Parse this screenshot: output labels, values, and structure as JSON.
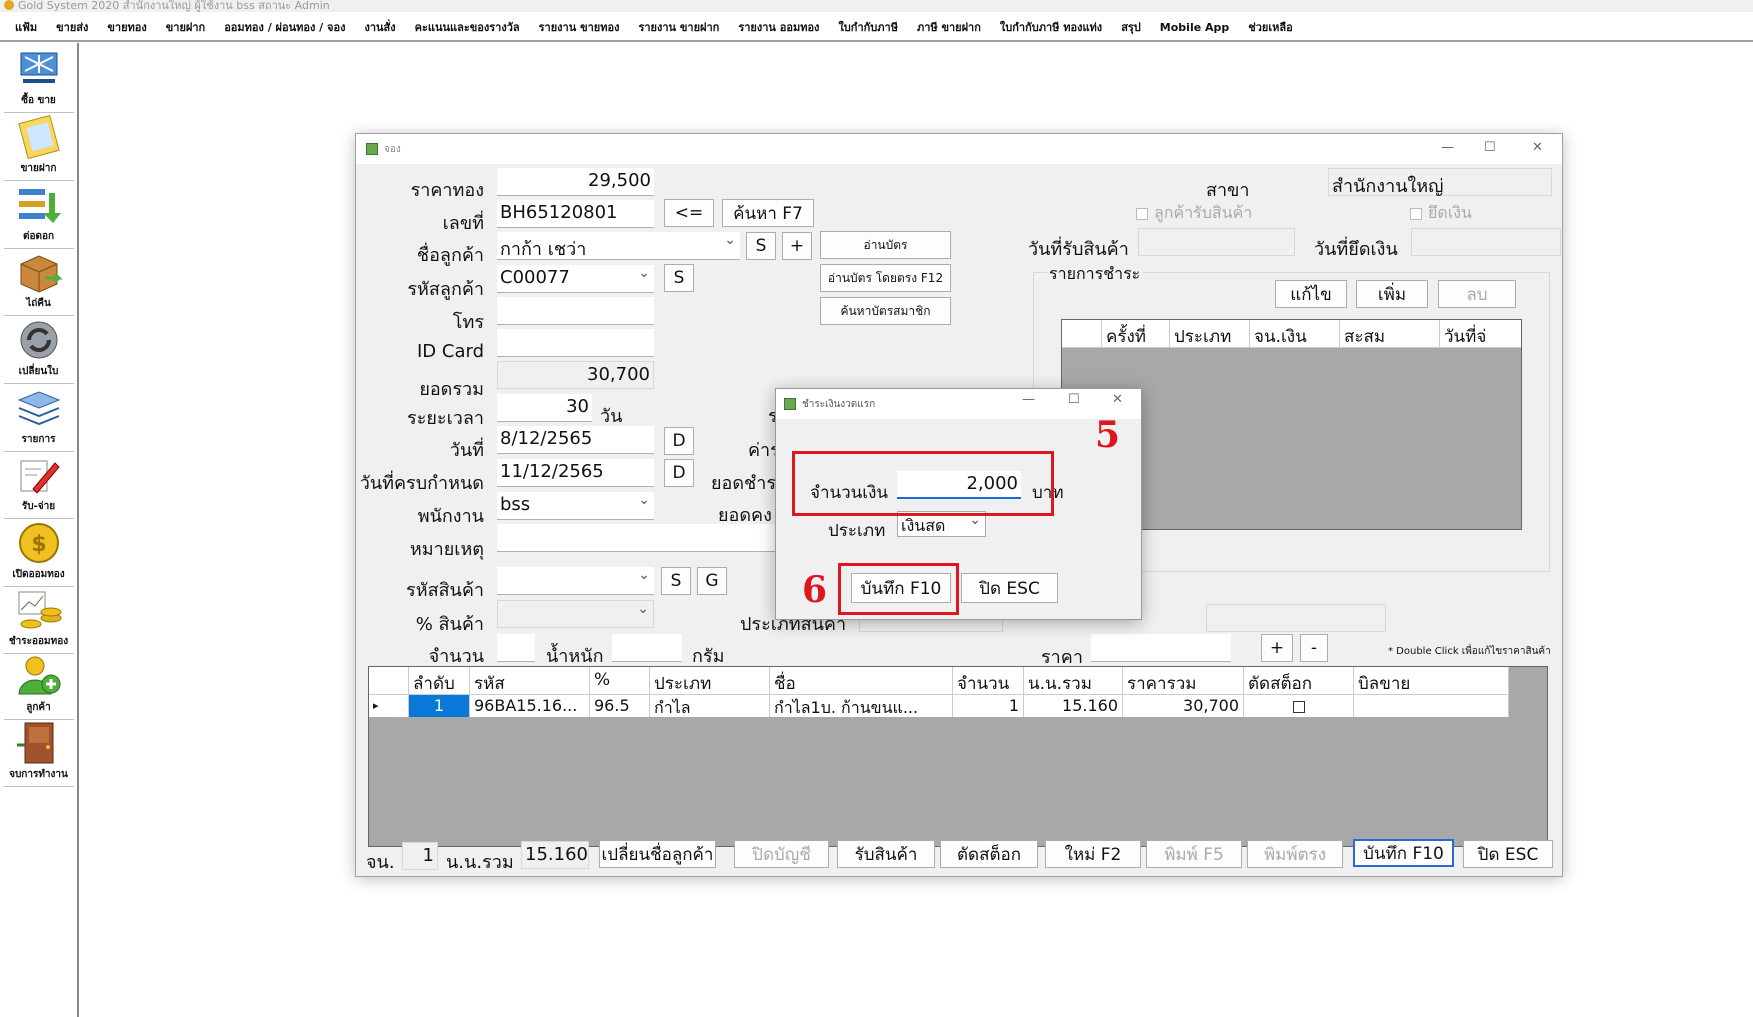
{
  "app": {
    "title": "Gold System 2020  สำนักงานใหญ่ ผู้ใช้งาน bss สถานะ Admin"
  },
  "menu": [
    "แฟ้ม",
    "ขายส่ง",
    "ขายทอง",
    "ขายฝาก",
    "ออมทอง / ผ่อนทอง / จอง",
    "งานสั่ง",
    "คะแนนและของรางวัล",
    "รายงาน ขายทอง",
    "รายงาน ขายฝาก",
    "รายงาน ออมทอง",
    "ใบกำกับภาษี",
    "ภาษี ขายฝาก",
    "ใบกำกับภาษี ทองแท่ง",
    "สรุป",
    "Mobile App",
    "ช่วยเหลือ"
  ],
  "sidebar": [
    {
      "label": "ซื้อ ขาย",
      "icon": "cart-icon"
    },
    {
      "label": "ขายฝาก",
      "icon": "clipboard-icon"
    },
    {
      "label": "ต่อดอก",
      "icon": "arrows-icon"
    },
    {
      "label": "ไถ่คืน",
      "icon": "box-icon"
    },
    {
      "label": "เปลี่ยนใบ",
      "icon": "refresh-icon"
    },
    {
      "label": "รายการ",
      "icon": "layers-icon"
    },
    {
      "label": "รับ-จ่าย",
      "icon": "pen-icon"
    },
    {
      "label": "เปิดออมทอง",
      "icon": "coin-icon"
    },
    {
      "label": "ชำระออมทอง",
      "icon": "coins-chart-icon"
    },
    {
      "label": "ลูกค้า",
      "icon": "user-add-icon"
    },
    {
      "label": "จบการทำงาน",
      "icon": "door-icon"
    }
  ],
  "window": {
    "title": "จอง",
    "labels": {
      "gold_price": "ราคาทอง",
      "doc_no": "เลขที่",
      "cust_name": "ชื่อลูกค้า",
      "cust_code": "รหัสลูกค้า",
      "phone": "โทร",
      "id_card": "ID Card",
      "total": "ยอดรวม",
      "period": "ระยะเวลา",
      "day_unit": "วัน",
      "date": "วันที่",
      "due_date": "วันที่ครบกำหนด",
      "staff": "พนักงาน",
      "note": "หมายเหตุ",
      "product_code": "รหัสสินค้า",
      "product_pct": "% สินค้า",
      "qty": "จำนวน",
      "weight": "น้ำหนัก",
      "gram": "กรัม",
      "branch": "สาขา",
      "receive_date": "วันที่รับสินค้า",
      "seize_date": "วันที่ยึดเงิน",
      "payment_list": "รายการชำระ",
      "fee_partial": "ค่าร",
      "paid_partial": "ยอดชำร",
      "remain_partial": "ยอดคง",
      "ptype_partial": "ประเภทสินค้า",
      "price": "ราคา",
      "r_partial": "ร",
      "qty_total": "จน.",
      "weight_total": "น.น.รวม"
    },
    "values": {
      "gold_price": "29,500",
      "doc_no": "BH65120801",
      "cust_name": "กาก้า เชว่า",
      "cust_code": "C00077",
      "phone": "",
      "id_card": "",
      "total": "30,700",
      "period": "30",
      "date": "8/12/2565",
      "due_date": "11/12/2565",
      "staff": "bss",
      "note": "",
      "branch": "สำนักงานใหญ่",
      "qty_total": "1",
      "weight_total": "15.160"
    },
    "buttons": {
      "prev": "<=",
      "search": "ค้นหา F7",
      "s": "S",
      "plus": "+",
      "read_card": "อ่านบัตร",
      "read_card_direct": "อ่านบัตร โดยตรง F12",
      "find_member": "ค้นหาบัตรสมาชิก",
      "d": "D",
      "g": "G",
      "edit": "แก้ไข",
      "add": "เพิ่ม",
      "delete": "ลบ",
      "minus": "-",
      "change_cust": "เปลี่ยนชื่อลูกค้า",
      "close_acc": "ปิดบัญชี",
      "receive": "รับสินค้า",
      "cut_stock": "ตัดสต็อก",
      "new": "ใหม่ F2",
      "print": "พิมพ์ F5",
      "print_direct": "พิมพ์ตรง",
      "save": "บันทึก F10",
      "close": "ปิด ESC"
    },
    "checks": {
      "cust_received": "ลูกค้ารับสินค้า",
      "seize_money": "ยึดเงิน"
    },
    "hint": "* Double Click เพื่อแก้ไขราคาสินค้า",
    "pay_grid": {
      "columns": [
        "",
        "ครั้งที่",
        "ประเภท",
        "จน.เงิน",
        "สะสม",
        "วันที่จ่"
      ]
    },
    "items_grid": {
      "columns": [
        "",
        "ลำดับ",
        "รหัส",
        "%",
        "ประเภท",
        "ชื่อ",
        "จำนวน",
        "น.น.รวม",
        "ราคารวม",
        "ตัดสต็อก",
        "บิลขาย"
      ],
      "rows": [
        [
          "▸",
          "1",
          "96BA15.16...",
          "96.5",
          "กำไล",
          "กำไล1บ. ก้านขนแ...",
          "1",
          "15.160",
          "30,700",
          "",
          ""
        ]
      ]
    }
  },
  "dialog": {
    "title": "ชำระเงินงวดแรก",
    "amount_label": "จำนวนเงิน",
    "amount_value": "2,000",
    "baht": "บาท",
    "type_label": "ประเภท",
    "type_value": "เงินสด",
    "save": "บันทึก F10",
    "close": "ปิด ESC"
  },
  "annotations": {
    "step5": "5",
    "step6": "6",
    "accent": "#e0161e"
  }
}
